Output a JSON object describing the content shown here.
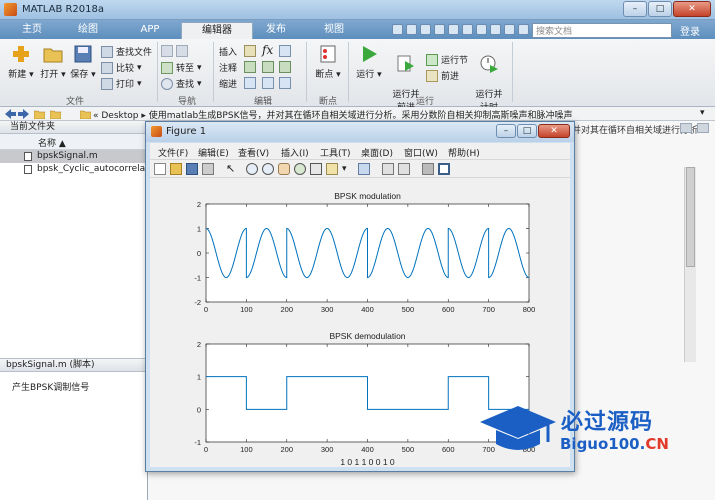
{
  "window": {
    "title": "MATLAB R2018a",
    "min": "–",
    "max": "□",
    "close": "✕"
  },
  "tabs": [
    {
      "label": "主页"
    },
    {
      "label": "绘图"
    },
    {
      "label": "APP"
    },
    {
      "label": "编辑器"
    },
    {
      "label": "发布"
    },
    {
      "label": "视图"
    }
  ],
  "search": {
    "placeholder": "搜索文档"
  },
  "login_label": "登录",
  "ribbon": {
    "file": {
      "new": "新建",
      "open": "打开",
      "save": "保存",
      "find_files": "查找文件",
      "compare": "比较",
      "print": "打印",
      "group": "文件"
    },
    "nav": {
      "goto": "转至",
      "find": "查找",
      "group": "导航"
    },
    "edit": {
      "insert": "插入",
      "comment": "注释",
      "indent": "缩进",
      "group": "编辑"
    },
    "breakpoints": {
      "breakpoint": "断点",
      "group": "断点"
    },
    "run": {
      "run": "运行",
      "run_advance": "运行并\n前进",
      "run_section": "运行节",
      "advance": "前进",
      "run_time": "运行并\n计时",
      "group": "运行"
    }
  },
  "address": {
    "path": "« Desktop ▸ 使用matlab生成BPSK信号，并对其在循环自相关域进行分析。采用分数阶自相关抑制高斯噪声和脉冲噪声"
  },
  "left_panel": {
    "header": "当前文件夹",
    "column": "名称 ▲",
    "files": [
      {
        "name": "bpskSignal.m",
        "selected": true
      },
      {
        "name": "bpsk_Cyclic_autocorrelati",
        "selected": false
      }
    ],
    "details_header": "bpskSignal.m  (脚本)",
    "details_text": "产生BPSK调制信号"
  },
  "right_panel": {
    "header_fragment": "并对其在循环自相关域进行分析"
  },
  "figure": {
    "title": "Figure 1",
    "menu": [
      "文件(F)",
      "编辑(E)",
      "查看(V)",
      "插入(I)",
      "工具(T)",
      "桌面(D)",
      "窗口(W)",
      "帮助(H)"
    ]
  },
  "chart_data": [
    {
      "type": "line",
      "title": "BPSK modulation",
      "xlabel": "",
      "ylabel": "",
      "xlim": [
        0,
        800
      ],
      "ylim": [
        -2,
        2
      ],
      "xticks": [
        0,
        100,
        200,
        300,
        400,
        500,
        600,
        700,
        800
      ],
      "yticks": [
        -2,
        -1,
        0,
        1,
        2
      ],
      "series": [
        {
          "description": "cos carrier, 1 cycle per 100 samples, phase inverted per bit",
          "bits": [
            1,
            0,
            1,
            1,
            0,
            0,
            1,
            0
          ],
          "samples_per_bit": 100,
          "amplitude": 1,
          "color": "#0072bd"
        }
      ]
    },
    {
      "type": "line",
      "title": "BPSK demodulation",
      "xlabel": "1 0 1 1 0 0 1 0",
      "ylabel": "",
      "xlim": [
        0,
        800
      ],
      "ylim": [
        -1,
        2
      ],
      "xticks": [
        0,
        100,
        200,
        300,
        400,
        500,
        600,
        700,
        800
      ],
      "yticks": [
        -1,
        0,
        1,
        2
      ],
      "series": [
        {
          "name": "",
          "bits": [
            1,
            0,
            1,
            1,
            0,
            0,
            1,
            0
          ],
          "samples_per_bit": 100,
          "color": "#0072bd"
        }
      ]
    }
  ],
  "watermark": {
    "main": "必过源码",
    "sub_a": "Biguo100.",
    "sub_b": "CN"
  }
}
